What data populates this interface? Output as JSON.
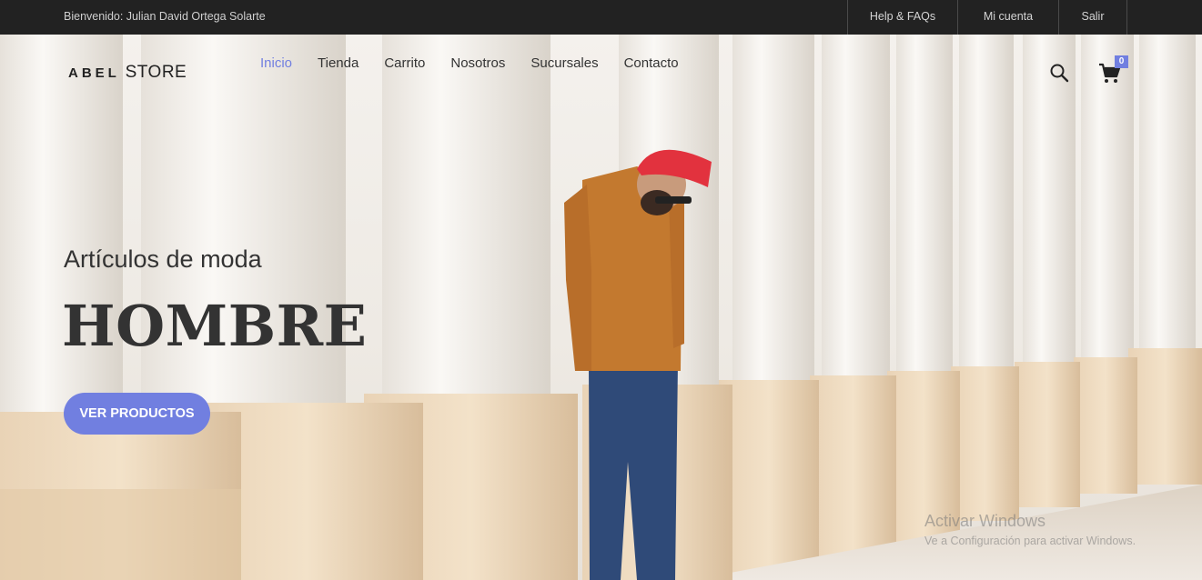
{
  "topbar": {
    "welcome": "Bienvenido: Julian David Ortega Solarte",
    "links": [
      "Help & FAQs",
      "Mi cuenta",
      "Salir"
    ]
  },
  "header": {
    "logo_bold": "ABEL",
    "logo_rest": "STORE",
    "nav": [
      "Inicio",
      "Tienda",
      "Carrito",
      "Nosotros",
      "Sucursales",
      "Contacto"
    ],
    "active_nav": "Inicio",
    "cart_count": "0"
  },
  "hero": {
    "subtitle": "Artículos de moda",
    "title": "HOMBRE",
    "button": "VER PRODUCTOS"
  },
  "watermark": {
    "line1": "Activar Windows",
    "line2": "Ve a Configuración para activar Windows."
  },
  "colors": {
    "accent": "#717fe0",
    "topbar_bg": "#222222",
    "text_dark": "#333333"
  },
  "icons": [
    "search-icon",
    "cart-icon"
  ]
}
